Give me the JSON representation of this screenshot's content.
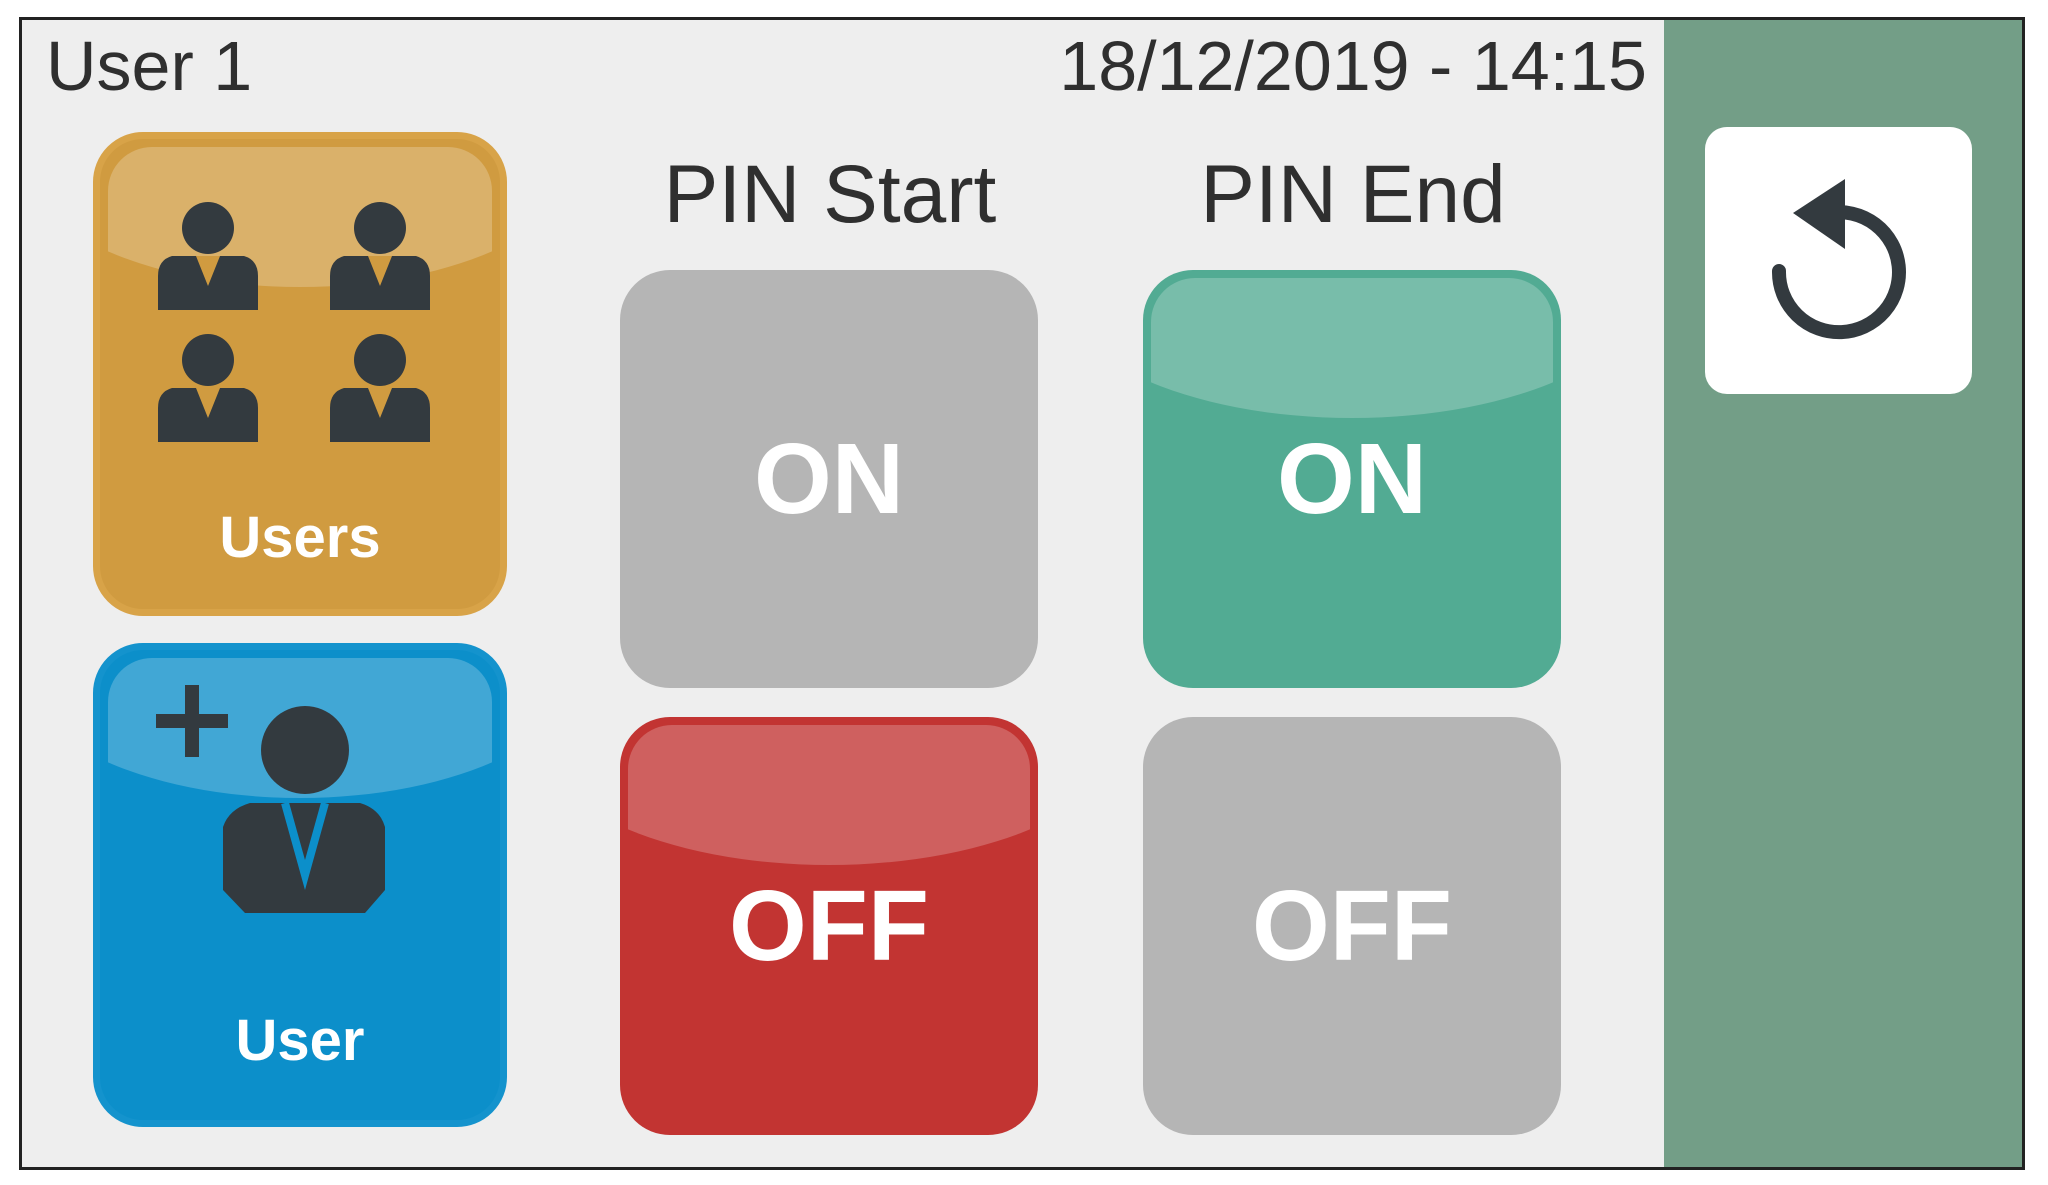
{
  "header": {
    "user_name": "User 1",
    "datetime": "18/12/2019 - 14:15"
  },
  "tiles": {
    "users": {
      "label": "Users",
      "icon": "users-group-icon"
    },
    "user": {
      "label": "User",
      "icon": "add-user-icon"
    }
  },
  "columns": [
    {
      "header": "PIN Start",
      "on": {
        "label": "ON",
        "active": false
      },
      "off": {
        "label": "OFF",
        "active": true
      }
    },
    {
      "header": "PIN End",
      "on": {
        "label": "ON",
        "active": true
      },
      "off": {
        "label": "OFF",
        "active": false
      }
    }
  ],
  "sidebar": {
    "back_icon": "undo-icon"
  },
  "colors": {
    "panel": "#739e87",
    "users_tile": "#d09b40",
    "user_tile": "#0c8fca",
    "on_active": "#52ab93",
    "off_active": "#c23432",
    "inactive": "#b5b5b5"
  }
}
